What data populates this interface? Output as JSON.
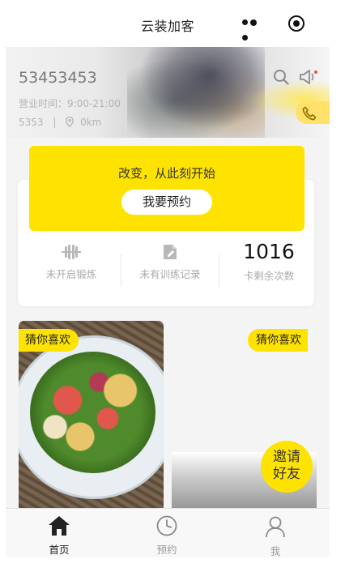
{
  "header": {
    "title": "云装加客",
    "more_icon": "more-dots-icon",
    "capsule_icon": "record-circle-icon"
  },
  "banner": {
    "shop_name": "53453453",
    "hours": "营业时间：9:00-21:00",
    "address": "5353",
    "separator": "|",
    "distance": "0km",
    "icons": [
      "search-icon",
      "speaker-icon",
      "phone-icon",
      "location-pin-icon"
    ]
  },
  "promo": {
    "slogan": "改变，从此刻开始",
    "button_label": "我要预约"
  },
  "stats": [
    {
      "label": "未开启锻炼",
      "icon": "dumbbell-icon"
    },
    {
      "label": "未有训练记录",
      "icon": "note-edit-icon"
    },
    {
      "value": "1016",
      "label": "卡剩余次数"
    }
  ],
  "recommend": {
    "tag_left": "猜你喜欢",
    "tag_right": "猜你喜欢",
    "invite_line1": "邀请",
    "invite_line2": "好友"
  },
  "tabbar": {
    "items": [
      {
        "label": "首页",
        "icon": "home-icon",
        "active": true
      },
      {
        "label": "预约",
        "icon": "clock-icon",
        "active": false
      },
      {
        "label": "我",
        "icon": "user-icon",
        "active": false
      }
    ]
  },
  "colors": {
    "accent": "#ffe300",
    "page_bg": "#f4f4f4",
    "muted_text": "#aaaaaa"
  }
}
